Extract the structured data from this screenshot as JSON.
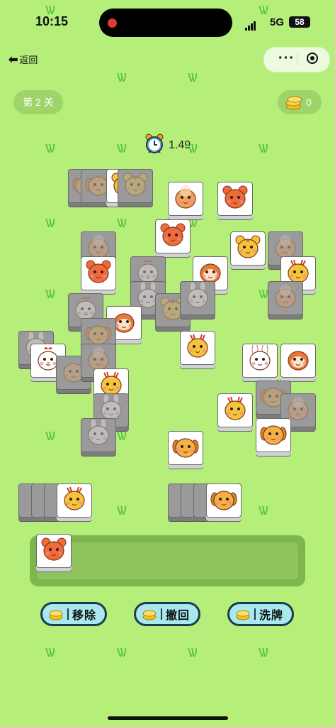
{
  "status_bar": {
    "time": "10:15",
    "network": "5G",
    "battery": "58"
  },
  "nav": {
    "back_label": "返回"
  },
  "game": {
    "level_label": "第 2 关",
    "coin_count": "0",
    "timer_value": "1.49",
    "powerups": [
      {
        "label": "移除"
      },
      {
        "label": "撤回"
      },
      {
        "label": "洗牌"
      }
    ]
  },
  "colors": {
    "background": "#b5ee79",
    "grass": "#56c341",
    "button_fill": "#a7e9ee",
    "button_border": "#1d3b4c"
  }
}
